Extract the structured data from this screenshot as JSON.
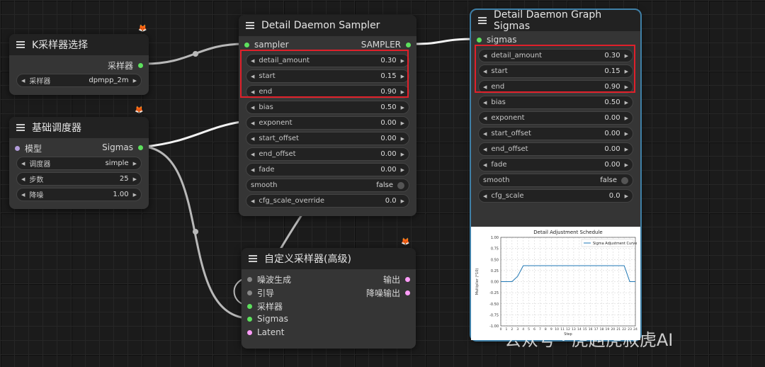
{
  "nodes": {
    "ksampler_select": {
      "title": "K采样器选择",
      "output": "采样器",
      "widgets": [
        {
          "label": "采样器",
          "value": "dpmpp_2m"
        }
      ]
    },
    "basic_scheduler": {
      "title": "基础调度器",
      "input": "模型",
      "output": "Sigmas",
      "widgets": [
        {
          "label": "调度器",
          "value": "simple"
        },
        {
          "label": "步数",
          "value": "25"
        },
        {
          "label": "降噪",
          "value": "1.00"
        }
      ]
    },
    "detail_daemon_sampler": {
      "title": "Detail Daemon Sampler",
      "input": "sampler",
      "output": "SAMPLER",
      "widgets": [
        {
          "label": "detail_amount",
          "value": "0.30"
        },
        {
          "label": "start",
          "value": "0.15"
        },
        {
          "label": "end",
          "value": "0.90"
        },
        {
          "label": "bias",
          "value": "0.50"
        },
        {
          "label": "exponent",
          "value": "0.00"
        },
        {
          "label": "start_offset",
          "value": "0.00"
        },
        {
          "label": "end_offset",
          "value": "0.00"
        },
        {
          "label": "fade",
          "value": "0.00"
        },
        {
          "label": "smooth",
          "value": "false"
        },
        {
          "label": "cfg_scale_override",
          "value": "0.0"
        }
      ]
    },
    "detail_daemon_graph": {
      "title": "Detail Daemon Graph Sigmas",
      "input": "sigmas",
      "widgets": [
        {
          "label": "detail_amount",
          "value": "0.30"
        },
        {
          "label": "start",
          "value": "0.15"
        },
        {
          "label": "end",
          "value": "0.90"
        },
        {
          "label": "bias",
          "value": "0.50"
        },
        {
          "label": "exponent",
          "value": "0.00"
        },
        {
          "label": "start_offset",
          "value": "0.00"
        },
        {
          "label": "end_offset",
          "value": "0.00"
        },
        {
          "label": "fade",
          "value": "0.00"
        },
        {
          "label": "smooth",
          "value": "false"
        },
        {
          "label": "cfg_scale",
          "value": "0.0"
        }
      ]
    },
    "custom_sampler": {
      "title": "自定义采样器(高级)",
      "inputs": [
        "噪波生成",
        "引导",
        "采样器",
        "Sigmas",
        "Latent"
      ],
      "outputs": [
        "输出",
        "降噪输出"
      ]
    }
  },
  "chart_data": {
    "type": "line",
    "title": "Detail Adjustment Schedule",
    "xlabel": "Step",
    "ylabel": "Multiplier (*10)",
    "legend": "Sigma Adjustment Curve",
    "legend_position": "top-right",
    "grid": true,
    "ylim": [
      -1.0,
      1.0
    ],
    "yticks": [
      "1.00",
      "0.75",
      "0.50",
      "0.25",
      "0.00",
      "-0.25",
      "-0.50",
      "-0.75",
      "-1.00"
    ],
    "xticks": [
      "0",
      "1",
      "2",
      "3",
      "4",
      "5",
      "6",
      "7",
      "8",
      "9",
      "10",
      "11",
      "12",
      "13",
      "14",
      "15",
      "16",
      "17",
      "18",
      "19",
      "20",
      "21",
      "22",
      "23",
      "24"
    ],
    "x": [
      0,
      1,
      2,
      3,
      4,
      5,
      6,
      7,
      8,
      9,
      10,
      11,
      12,
      13,
      14,
      15,
      16,
      17,
      18,
      19,
      20,
      21,
      22,
      23,
      24
    ],
    "y": [
      0,
      0,
      0,
      0.12,
      0.36,
      0.36,
      0.36,
      0.36,
      0.36,
      0.36,
      0.36,
      0.36,
      0.36,
      0.36,
      0.36,
      0.36,
      0.36,
      0.36,
      0.36,
      0.36,
      0.36,
      0.36,
      0.36,
      0,
      0
    ],
    "color": "#1f77b4"
  },
  "colors": {
    "wire": "#b8b8b8",
    "sampler_dot": "#5de05d",
    "model_dot": "#b39ddb",
    "latent_dot": "#ff9cf9",
    "highlight": "#e0202a"
  },
  "watermark": "公众号 · 虎赳虎叔虎AI"
}
